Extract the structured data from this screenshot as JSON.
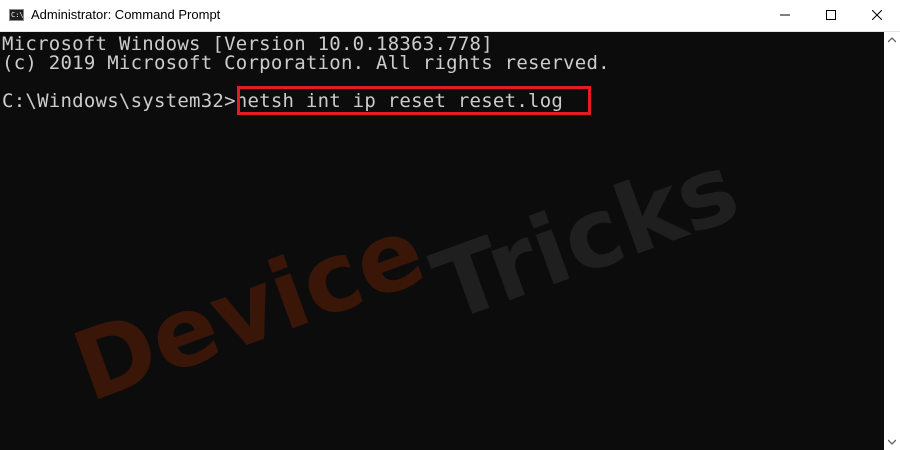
{
  "window": {
    "title": "Administrator: Command Prompt",
    "app_icon_text": "C:\\",
    "icons": {
      "app": "command-prompt-icon",
      "minimize": "minimize-icon",
      "maximize": "maximize-icon",
      "close": "close-icon",
      "scroll_up": "chevron-up-icon",
      "scroll_down": "chevron-down-icon"
    }
  },
  "console": {
    "lines": [
      "Microsoft Windows [Version 10.0.18363.778]",
      "(c) 2019 Microsoft Corporation. All rights reserved.",
      "",
      "C:\\Windows\\system32>netsh int ip reset reset.log"
    ],
    "highlighted_command": "netsh int ip reset reset.log"
  },
  "watermark": {
    "word1": "Device",
    "word2": "Tricks"
  },
  "colors": {
    "console_bg": "#0c0c0c",
    "console_text": "#cccccc",
    "highlight_border": "#e31b23",
    "titlebar_bg": "#ffffff",
    "watermark_1": "#3a1608",
    "watermark_2": "#1f1f1f"
  }
}
